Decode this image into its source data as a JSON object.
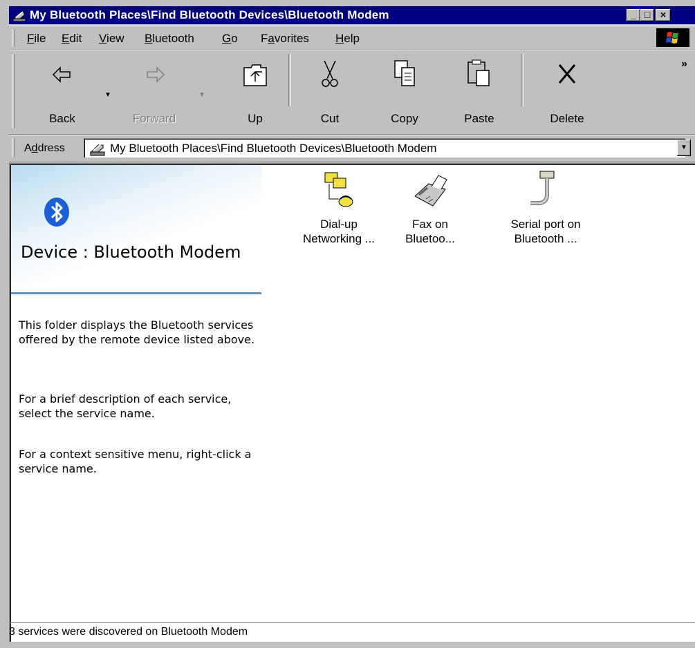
{
  "window": {
    "title": "My Bluetooth Places\\Find Bluetooth Devices\\Bluetooth Modem",
    "controls": {
      "minimize": "_",
      "maximize": "□",
      "close": "×"
    }
  },
  "menu": {
    "items": [
      {
        "label_pre": "",
        "accel": "F",
        "label_post": "ile"
      },
      {
        "label_pre": "",
        "accel": "E",
        "label_post": "dit"
      },
      {
        "label_pre": "",
        "accel": "V",
        "label_post": "iew"
      },
      {
        "label_pre": "",
        "accel": "B",
        "label_post": "luetooth"
      },
      {
        "label_pre": "",
        "accel": "G",
        "label_post": "o"
      },
      {
        "label_pre": "F",
        "accel": "a",
        "label_post": "vorites"
      },
      {
        "label_pre": "",
        "accel": "H",
        "label_post": "elp"
      }
    ]
  },
  "toolbar": {
    "back": "Back",
    "forward": "Forward",
    "up": "Up",
    "cut": "Cut",
    "copy": "Copy",
    "paste": "Paste",
    "delete": "Delete",
    "overflow": "»"
  },
  "address": {
    "label_pre": "A",
    "label_accel": "d",
    "label_post": "dress",
    "value": "My Bluetooth Places\\Find Bluetooth Devices\\Bluetooth Modem"
  },
  "panel": {
    "title": "Device : Bluetooth Modem",
    "paragraphs": [
      "This folder displays the Bluetooth services offered by the remote device listed above.",
      "For a brief description of each service, select the service name.",
      "For a context sensitive menu, right-click a service name."
    ]
  },
  "services": [
    {
      "line1": "Dial-up",
      "line2": "Networking ...",
      "icon": "dialup-networking-icon"
    },
    {
      "line1": "Fax on",
      "line2": "Bluetoo...",
      "icon": "fax-icon"
    },
    {
      "line1": "Serial port on",
      "line2": "Bluetooth ...",
      "icon": "serial-port-icon"
    }
  ],
  "status": {
    "text": "3 services were discovered on Bluetooth Modem"
  },
  "colors": {
    "titlebar": "#000080",
    "face": "#c0c0c0",
    "accent_rule": "#5b8fc8",
    "bluetooth": "#1a5fd6"
  }
}
